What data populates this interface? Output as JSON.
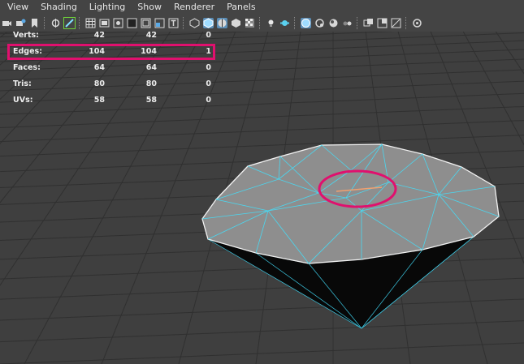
{
  "menu": {
    "items": [
      "View",
      "Shading",
      "Lighting",
      "Show",
      "Renderer",
      "Panels"
    ]
  },
  "toolbar": {
    "icons": [
      "camera-icon",
      "camera-attributes-icon",
      "bookmark-icon",
      "image-plane-icon",
      "grease-pencil-icon",
      "grid-icon",
      "film-gate-icon",
      "resolution-gate-icon",
      "gate-mask-icon",
      "field-chart-icon",
      "safe-action-icon",
      "safe-title-icon",
      "wireframe-icon",
      "smooth-shade-icon",
      "wireframe-on-shaded-icon",
      "default-material-icon",
      "lighting-icon",
      "shadows-icon",
      "isolate-select-icon",
      "xray-icon",
      "xray-joints-icon",
      "xray-components-icon",
      "screen-space-ao-icon",
      "motion-blur-icon",
      "anti-aliasing-icon",
      "depth-of-field-icon",
      "undo-icon"
    ]
  },
  "hud": {
    "rows": [
      {
        "label": "Verts:",
        "c1": "42",
        "c2": "42",
        "c3": "0"
      },
      {
        "label": "Edges:",
        "c1": "104",
        "c2": "104",
        "c3": "1"
      },
      {
        "label": "Faces:",
        "c1": "64",
        "c2": "64",
        "c3": "0"
      },
      {
        "label": "Tris:",
        "c1": "80",
        "c2": "80",
        "c3": "0"
      },
      {
        "label": "UVs:",
        "c1": "58",
        "c2": "58",
        "c3": "0"
      }
    ]
  },
  "colors": {
    "background": "#3f3f3f",
    "menubar": "#444444",
    "grid_line": "#303030",
    "wireframe": "#4ad7f0",
    "selected_edge": "#f0a070",
    "annotation": "#e0106e",
    "mesh_top": "#909090",
    "mesh_bottom": "#0a0a0a"
  }
}
